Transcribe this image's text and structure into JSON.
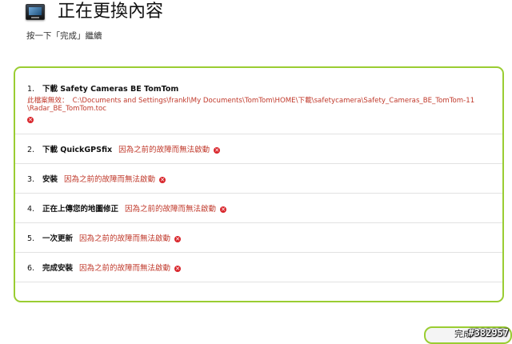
{
  "header": {
    "title": "正在更換內容",
    "subtitle": "按一下「完成」繼續"
  },
  "steps": [
    {
      "num": "1.",
      "label": "下載 Safety Cameras BE TomTom",
      "error_label": "此檔案無效：",
      "error_path_1": "C:\\Documents and Settings\\frankl\\My Documents\\TomTom\\HOME\\下載\\safetycamera\\Safety_Cameras_BE_TomTom-11",
      "error_path_2": "\\Radar_BE_TomTom.toc"
    },
    {
      "num": "2.",
      "label": "下載 QuickGPSfix",
      "error": "因為之前的故障而無法啟動"
    },
    {
      "num": "3.",
      "label": "安裝",
      "error": "因為之前的故障而無法啟動"
    },
    {
      "num": "4.",
      "label": "正在上傳您的地圖修正",
      "error": "因為之前的故障而無法啟動"
    },
    {
      "num": "5.",
      "label": "一次更新",
      "error": "因為之前的故障而無法啟動"
    },
    {
      "num": "6.",
      "label": "完成安裝",
      "error": "因為之前的故障而無法啟動"
    }
  ],
  "footer": {
    "done_label": "完成"
  },
  "watermark": "#382957",
  "icons": {
    "error": "error-x-icon",
    "app": "tomtom-device-icon"
  },
  "colors": {
    "accent": "#9acd32",
    "error": "#c0392b"
  }
}
